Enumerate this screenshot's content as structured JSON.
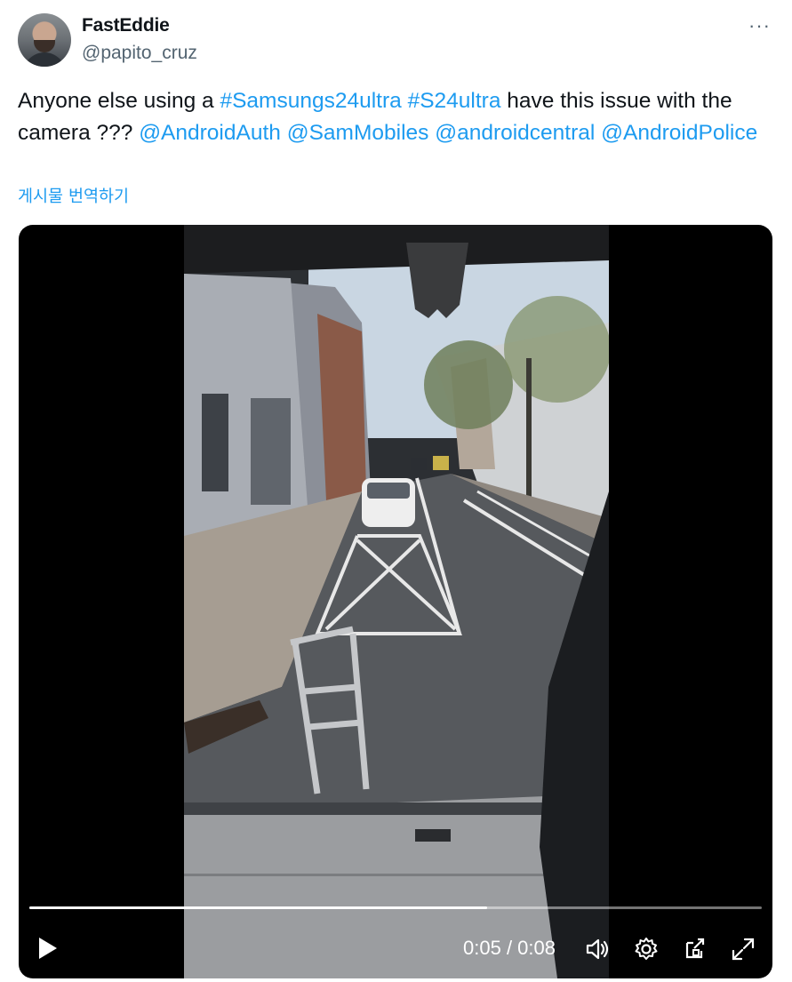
{
  "author": {
    "display_name": "FastEddie",
    "handle": "@papito_cruz",
    "avatar_icon": "user-avatar"
  },
  "more_icon": "more-options-icon",
  "more_label": "···",
  "tweet": {
    "text_parts": [
      {
        "text": "Anyone else using a ",
        "type": "plain"
      },
      {
        "text": "#Samsungs24ultra",
        "type": "hashtag"
      },
      {
        "text": " ",
        "type": "plain"
      },
      {
        "text": "#S24ultra",
        "type": "hashtag"
      },
      {
        "text": " have this issue with the camera ??? ",
        "type": "plain"
      },
      {
        "text": "@AndroidAuth",
        "type": "mention"
      },
      {
        "text": " ",
        "type": "plain"
      },
      {
        "text": "@SamMobiles",
        "type": "mention"
      },
      {
        "text": " ",
        "type": "plain"
      },
      {
        "text": "@androidcentral",
        "type": "mention"
      },
      {
        "text": " ",
        "type": "plain"
      },
      {
        "text": "@AndroidPolice",
        "type": "mention"
      }
    ],
    "translate_label": "게시물 번역하기"
  },
  "video": {
    "current_time": "0:05",
    "duration": "0:08",
    "time_separator": " / ",
    "progress": 0.625,
    "icons": [
      "play-icon",
      "volume-icon",
      "settings-icon",
      "pop-out-icon",
      "fullscreen-icon"
    ]
  },
  "colors": {
    "link": "#1d9bf0",
    "text": "#0f1419",
    "muted": "#536471"
  }
}
